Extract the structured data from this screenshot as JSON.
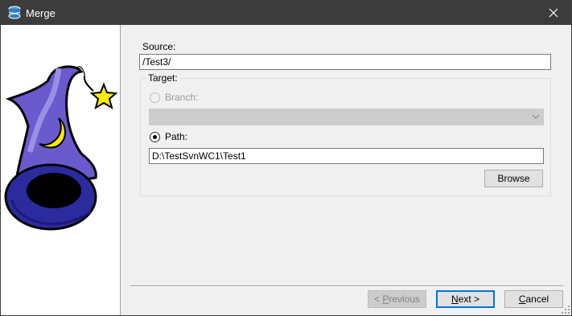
{
  "window": {
    "title": "Merge",
    "title_icon": "tortoisesvn-icon"
  },
  "source": {
    "label": "Source:",
    "value": "/Test3/"
  },
  "target": {
    "legend": "Target:",
    "branch_label": "Branch:",
    "branch_value": "",
    "path_label": "Path:",
    "path_value": "D:\\TestSvnWC1\\Test1",
    "browse_label": "Browse",
    "selected": "path"
  },
  "buttons": {
    "previous": "< Previous",
    "next": "Next >",
    "cancel": "Cancel"
  },
  "colors": {
    "titlebar": "#3c3c3c",
    "accent": "#0078d7",
    "hat": "#6a5acd"
  }
}
